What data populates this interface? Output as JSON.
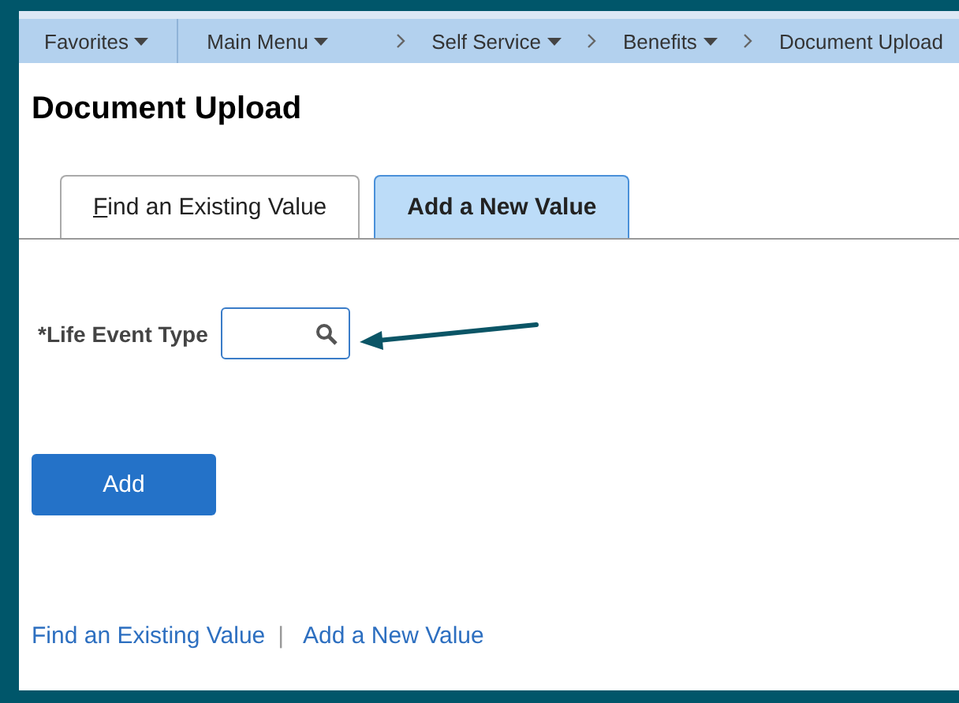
{
  "nav": [
    {
      "label": "Favorites",
      "kind": "menu"
    },
    {
      "label": "Main Menu",
      "kind": "menu"
    },
    {
      "label": "Self Service",
      "kind": "menu"
    },
    {
      "label": "Benefits",
      "kind": "menu"
    },
    {
      "label": "Document Upload",
      "kind": "page"
    }
  ],
  "title": "Document Upload",
  "tabs": [
    {
      "label": "Find an Existing Value",
      "selected": false
    },
    {
      "label": "Add a New Value",
      "selected": true
    }
  ],
  "field": {
    "label": "*Life Event Type"
  },
  "add_button": "Add",
  "footer_links": [
    {
      "label": "Find an Existing Value"
    },
    {
      "label": "Add a New Value"
    }
  ],
  "separator": "|"
}
